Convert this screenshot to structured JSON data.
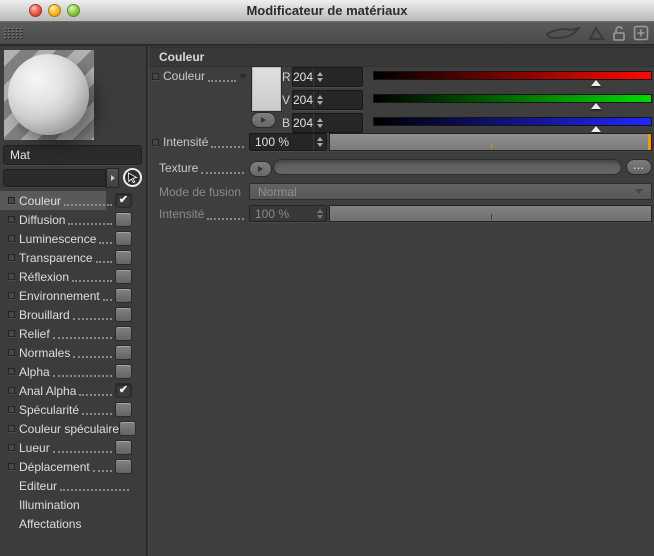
{
  "window": {
    "title": "Modificateur de matériaux"
  },
  "toolbar": {
    "icons": [
      "eye-icon",
      "triangle-icon",
      "lock-open-icon",
      "add-box-icon"
    ]
  },
  "sidebar": {
    "material_name": "Mat",
    "channels": [
      {
        "label": "Couleur",
        "checkbox": true,
        "checked": true,
        "selected": true,
        "leader": true
      },
      {
        "label": "Diffusion",
        "checkbox": true,
        "checked": false,
        "selected": false,
        "leader": true
      },
      {
        "label": "Luminescence",
        "checkbox": true,
        "checked": false,
        "selected": false,
        "leader": true
      },
      {
        "label": "Transparence",
        "checkbox": true,
        "checked": false,
        "selected": false,
        "leader": true
      },
      {
        "label": "Réflexion",
        "checkbox": true,
        "checked": false,
        "selected": false,
        "leader": true
      },
      {
        "label": "Environnement",
        "checkbox": true,
        "checked": false,
        "selected": false,
        "leader": true
      },
      {
        "label": "Brouillard",
        "checkbox": true,
        "checked": false,
        "selected": false,
        "leader": true
      },
      {
        "label": "Relief",
        "checkbox": true,
        "checked": false,
        "selected": false,
        "leader": true
      },
      {
        "label": "Normales",
        "checkbox": true,
        "checked": false,
        "selected": false,
        "leader": true
      },
      {
        "label": "Alpha",
        "checkbox": true,
        "checked": false,
        "selected": false,
        "leader": true
      },
      {
        "label": "Anal Alpha",
        "checkbox": true,
        "checked": true,
        "selected": false,
        "leader": true
      },
      {
        "label": "Spécularité",
        "checkbox": true,
        "checked": false,
        "selected": false,
        "leader": true
      },
      {
        "label": "Couleur spéculaire",
        "checkbox": true,
        "checked": false,
        "selected": false,
        "leader": false
      },
      {
        "label": "Lueur",
        "checkbox": true,
        "checked": false,
        "selected": false,
        "leader": true
      },
      {
        "label": "Déplacement",
        "checkbox": true,
        "checked": false,
        "selected": false,
        "leader": true
      },
      {
        "label": "Editeur",
        "checkbox": false,
        "checked": false,
        "selected": false,
        "leader": true
      },
      {
        "label": "Illumination",
        "checkbox": false,
        "checked": false,
        "selected": false,
        "leader": false
      },
      {
        "label": "Affectations",
        "checkbox": false,
        "checked": false,
        "selected": false,
        "leader": false
      }
    ]
  },
  "panel": {
    "header": "Couleur",
    "color": {
      "label": "Couleur",
      "swatch_hex": "#d2d2d2",
      "channels": [
        {
          "key": "R",
          "value": 204,
          "max": 255,
          "color": "#ff0800"
        },
        {
          "key": "V",
          "value": 204,
          "max": 255,
          "color": "#00dc00"
        },
        {
          "key": "B",
          "value": 204,
          "max": 255,
          "color": "#2226ff"
        }
      ]
    },
    "intensity": {
      "label": "Intensité",
      "value": "100 %",
      "percent": 100
    },
    "texture": {
      "label": "Texture",
      "value": "",
      "browse_label": "..."
    },
    "blend_mode": {
      "label": "Mode de fusion",
      "value": "Normal",
      "disabled": true
    },
    "intensity2": {
      "label": "Intensité",
      "value": "100 %",
      "percent": 100,
      "disabled": true
    }
  },
  "colors": {
    "accent_orange": "#f29a00",
    "panel_bg": "#3e3e3e",
    "field_bg": "#262626",
    "selected_row": "#595959"
  }
}
